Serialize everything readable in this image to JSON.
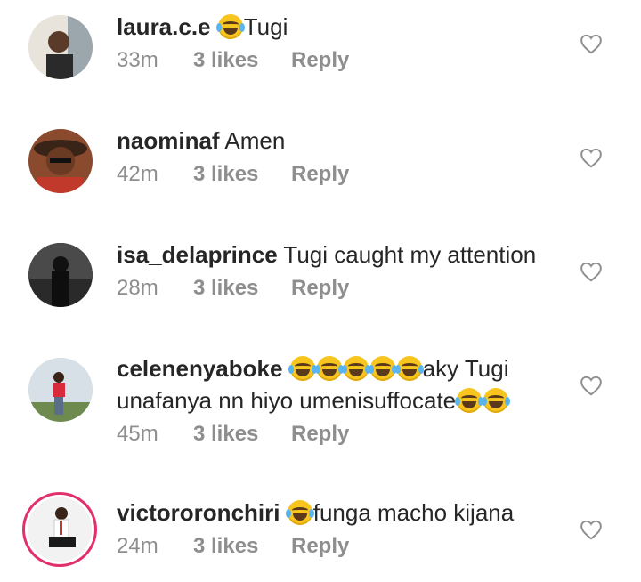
{
  "comments": [
    {
      "username": "laura.c.e",
      "before_emoji": "",
      "emojis_mid": 1,
      "text": "Tugi",
      "text2": "",
      "emojis_end": 0,
      "time": "33m",
      "likes": "3 likes",
      "reply": "Reply"
    },
    {
      "username": "naominaf",
      "before_emoji": "",
      "emojis_mid": 0,
      "text": "Amen",
      "text2": "",
      "emojis_end": 0,
      "time": "42m",
      "likes": "3 likes",
      "reply": "Reply"
    },
    {
      "username": "isa_delaprince",
      "before_emoji": "",
      "emojis_mid": 0,
      "text": "Tugi caught my attention",
      "text2": "",
      "emojis_end": 0,
      "time": "28m",
      "likes": "3 likes",
      "reply": "Reply"
    },
    {
      "username": "celenenyaboke",
      "before_emoji": "",
      "emojis_mid": 5,
      "text": "aky Tugi",
      "text2": "unafanya nn hiyo umenisuffocate",
      "emojis_end": 2,
      "time": "45m",
      "likes": "3 likes",
      "reply": "Reply"
    },
    {
      "username": "victororonchiri",
      "before_emoji": "",
      "emojis_mid": 1,
      "text": "funga macho kijana",
      "text2": "",
      "emojis_end": 0,
      "time": "24m",
      "likes": "3 likes",
      "reply": "Reply"
    }
  ],
  "icons": {
    "like": "heart-outline-icon",
    "emoji": "face-with-tears-of-joy"
  }
}
